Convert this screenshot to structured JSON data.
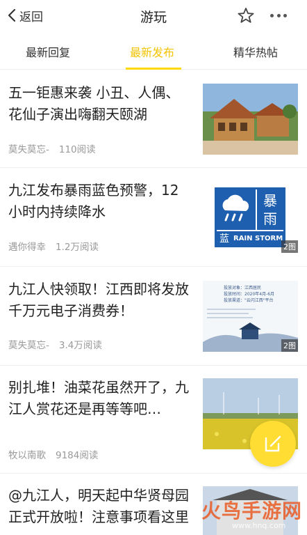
{
  "nav": {
    "back_label": "返回",
    "title": "游玩"
  },
  "tabs": [
    {
      "label": "最新回复"
    },
    {
      "label": "最新发布"
    },
    {
      "label": "精华热帖"
    }
  ],
  "posts": [
    {
      "title": "五一钜惠来袭 小丑、人偶、花仙子演出嗨翻天颐湖",
      "author": "莫失莫忘-",
      "views": "110阅读"
    },
    {
      "title": "九江发布暴雨蓝色预警，12小时内持续降水",
      "author": "遇你得幸",
      "views": "1.2万阅读",
      "badge": "2图",
      "storm_text_1": "暴",
      "storm_text_2": "雨",
      "storm_text_3": "蓝",
      "storm_text_4": "RAIN STORM"
    },
    {
      "title": "九江人快领取！江西即将发放千万元电子消费券！",
      "author": "莫失莫忘-",
      "views": "3.4万阅读",
      "badge": "2图",
      "doc_line_1": "投放对象：江西居民",
      "doc_line_2": "投放时间：2020年4月-6月",
      "doc_line_3": "投放渠道：\"云闪江西\"平台"
    },
    {
      "title": "别扎堆！油菜花虽然开了，九江人赏花还是再等等吧…",
      "author": "牧以南歌",
      "views": "9184阅读"
    },
    {
      "title": "@九江人，明天起中华贤母园正式开放啦！注意事项看这里"
    }
  ],
  "watermark": {
    "text": "火鸟手游网",
    "url": "www.hnq.com"
  },
  "colors": {
    "accent": "#ffd800",
    "active_tab": "#f5c400",
    "storm_blue": "#1f5fb0"
  }
}
